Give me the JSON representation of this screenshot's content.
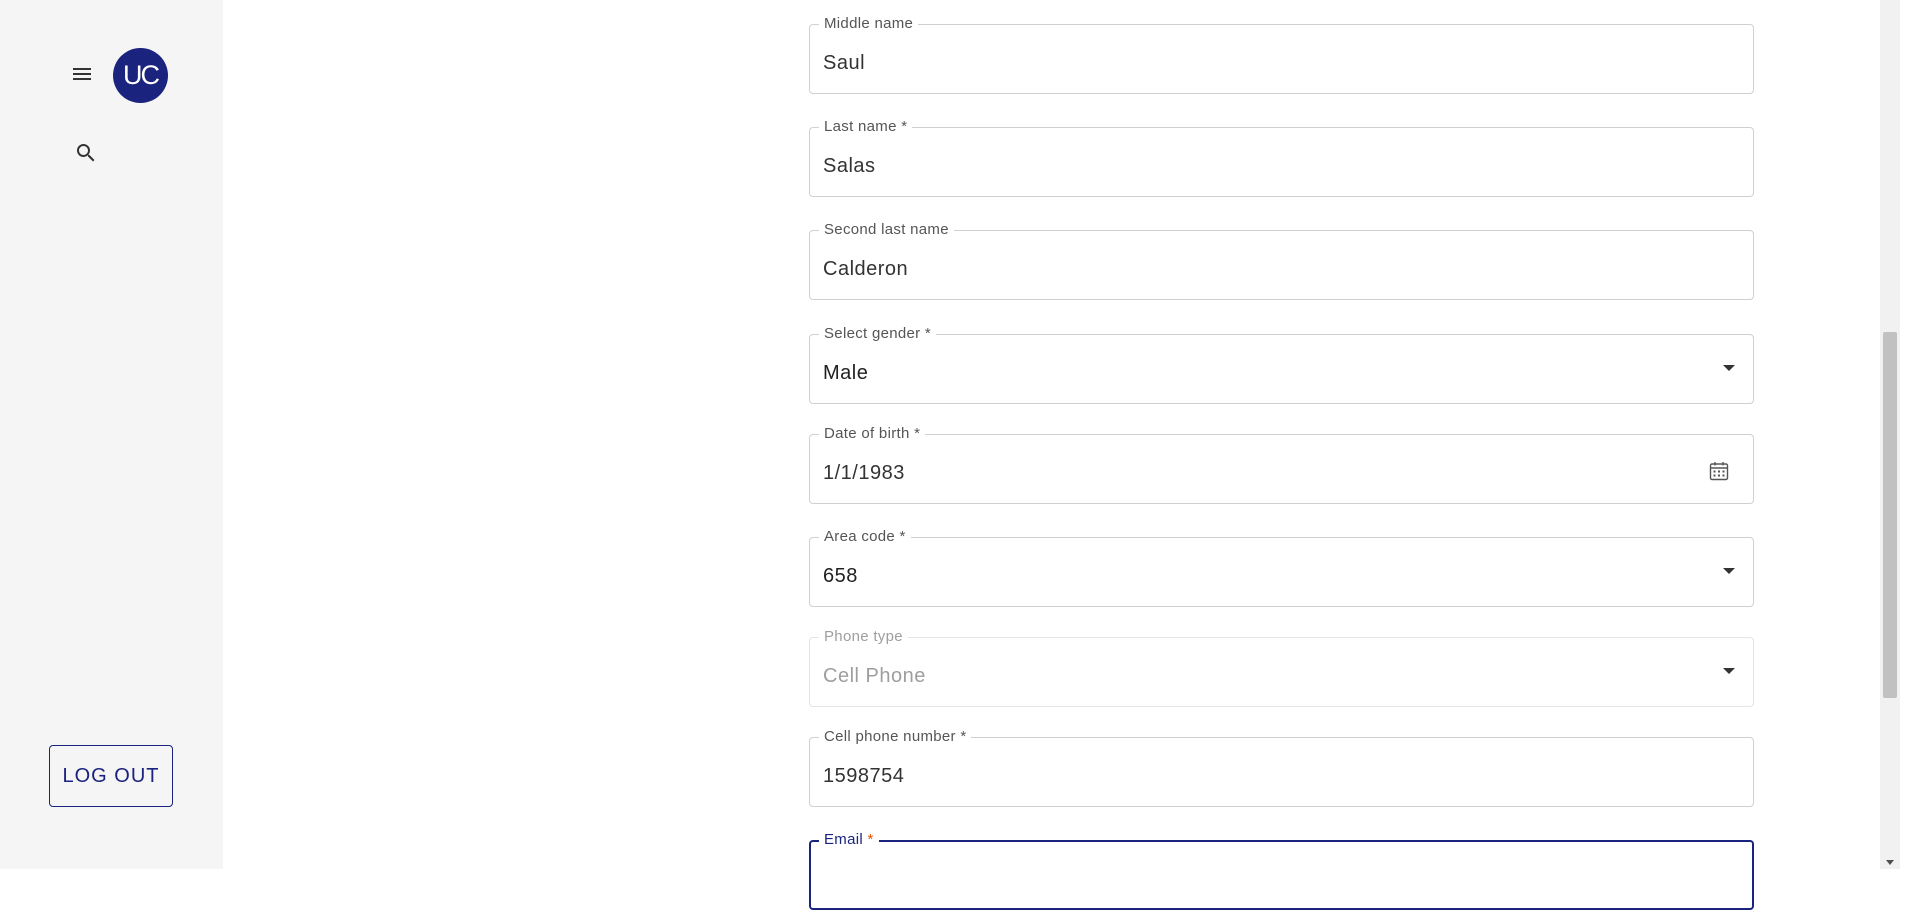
{
  "sidebar": {
    "menu_icon": "menu-icon",
    "avatar_initials": "UC",
    "search_icon": "search-icon",
    "logout_label": "LOG OUT"
  },
  "form": {
    "middle_name": {
      "label": "Middle name",
      "value": "Saul"
    },
    "last_name": {
      "label": "Last name *",
      "value": "Salas"
    },
    "second_last_name": {
      "label": "Second last name",
      "value": "Calderon"
    },
    "gender": {
      "label": "Select gender *",
      "value": "Male"
    },
    "date_of_birth": {
      "label": "Date of birth *",
      "value": "1/1/1983"
    },
    "area_code": {
      "label": "Area code *",
      "value": "658"
    },
    "phone_type": {
      "label": "Phone type",
      "value": "Cell Phone"
    },
    "cell_phone_number": {
      "label": "Cell phone number *",
      "value": "1598754"
    },
    "email": {
      "label": "Email",
      "required_mark": "*",
      "value": ""
    }
  },
  "colors": {
    "accent": "#1a237e",
    "sidebar_bg": "#f5f5f5",
    "required_focus": "#e65100"
  }
}
